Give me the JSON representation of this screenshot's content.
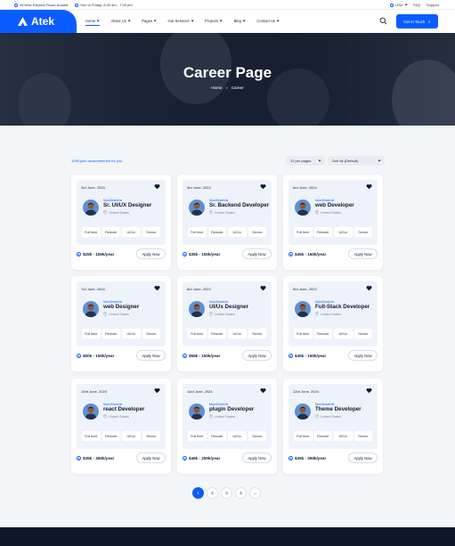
{
  "topbar": {
    "address": "45 New Eskaton Road, Austria",
    "hours": "Sun to Friday: 8.00 am - 7.00 pm",
    "currency": "USD",
    "faq": "FAQ",
    "support": "Support"
  },
  "header": {
    "logo_text": "Atek",
    "nav": [
      "Home",
      "About Us",
      "Pages",
      "Our Services",
      "Projects",
      "Blog",
      "Contact Us"
    ],
    "cta_label": "Get In Touch"
  },
  "hero": {
    "title": "Career Page",
    "breadcrumb": [
      "Home",
      "»",
      "Career"
    ]
  },
  "filters": {
    "found_text": "1099 jobs recommended for you",
    "per_page": "12 per pages",
    "sort": "Sort by (Default)"
  },
  "jobs": [
    {
      "date": "3rd June, 2024",
      "company": "MoceDesetche",
      "title": "Sr. UI/UX Designer",
      "location": "United States",
      "tags": [
        "Full time",
        "Remote",
        "UI/Ux",
        "Senior"
      ],
      "salary": "$25k - 150k/year",
      "apply": "Apply Now"
    },
    {
      "date": "3rd June, 2024",
      "company": "MoceDesetche",
      "title": "Sr. Backend Developer",
      "location": "United States",
      "tags": [
        "Full time",
        "Remote",
        "UI/Ux",
        "Senior"
      ],
      "salary": "$35k - 150k/year",
      "apply": "Apply Now"
    },
    {
      "date": "6rd June, 2024",
      "company": "MoceDesetche",
      "title": "web Developer",
      "location": "United States",
      "tags": [
        "Full time",
        "Remote",
        "UI/Ux",
        "Senior"
      ],
      "salary": "$45k - 150k/year",
      "apply": "Apply Now"
    },
    {
      "date": "7rd June, 2024",
      "company": "MoceDesetche",
      "title": "web Designer",
      "location": "United States",
      "tags": [
        "Full time",
        "Remote",
        "UI/Ux",
        "Senior"
      ],
      "salary": "$50k - 150k/year",
      "apply": "Apply Now"
    },
    {
      "date": "8rd June, 2024",
      "company": "MoceDesetche",
      "title": "UI/Ux Designer",
      "location": "United States",
      "tags": [
        "Full time",
        "Remote",
        "UI/Ux",
        "Senior"
      ],
      "salary": "$55k - 150k/year",
      "apply": "Apply Now"
    },
    {
      "date": "9rd June, 2024",
      "company": "MoceDesetche",
      "title": "Full-Stack Developer",
      "location": "United States",
      "tags": [
        "Full time",
        "Remote",
        "UI/Ux",
        "Senior"
      ],
      "salary": "$45k - 150k/year",
      "apply": "Apply Now"
    },
    {
      "date": "10rd June, 2024",
      "company": "MoceDesetche",
      "title": "react Developer",
      "location": "United States",
      "tags": [
        "Full time",
        "Remote",
        "UI/Ux",
        "Senior"
      ],
      "salary": "$35k - 350k/year",
      "apply": "Apply Now"
    },
    {
      "date": "11rd June, 2024",
      "company": "MoceDesetche",
      "title": "plugin Developer",
      "location": "United States",
      "tags": [
        "Full time",
        "Remote",
        "UI/Ux",
        "Senior"
      ],
      "salary": "$45k - 250k/year",
      "apply": "Apply Now"
    },
    {
      "date": "12rd June, 2024",
      "company": "MoceDesetche",
      "title": "Theme Developer",
      "location": "United States",
      "tags": [
        "Full time",
        "Remote",
        "UI/Ux",
        "Senior"
      ],
      "salary": "$35k - 350k/year",
      "apply": "Apply Now"
    }
  ],
  "pagination": [
    "1",
    "2",
    "3",
    "4",
    "→"
  ],
  "colors": {
    "accent": "#0b5cff",
    "footer": "#0f1628"
  }
}
